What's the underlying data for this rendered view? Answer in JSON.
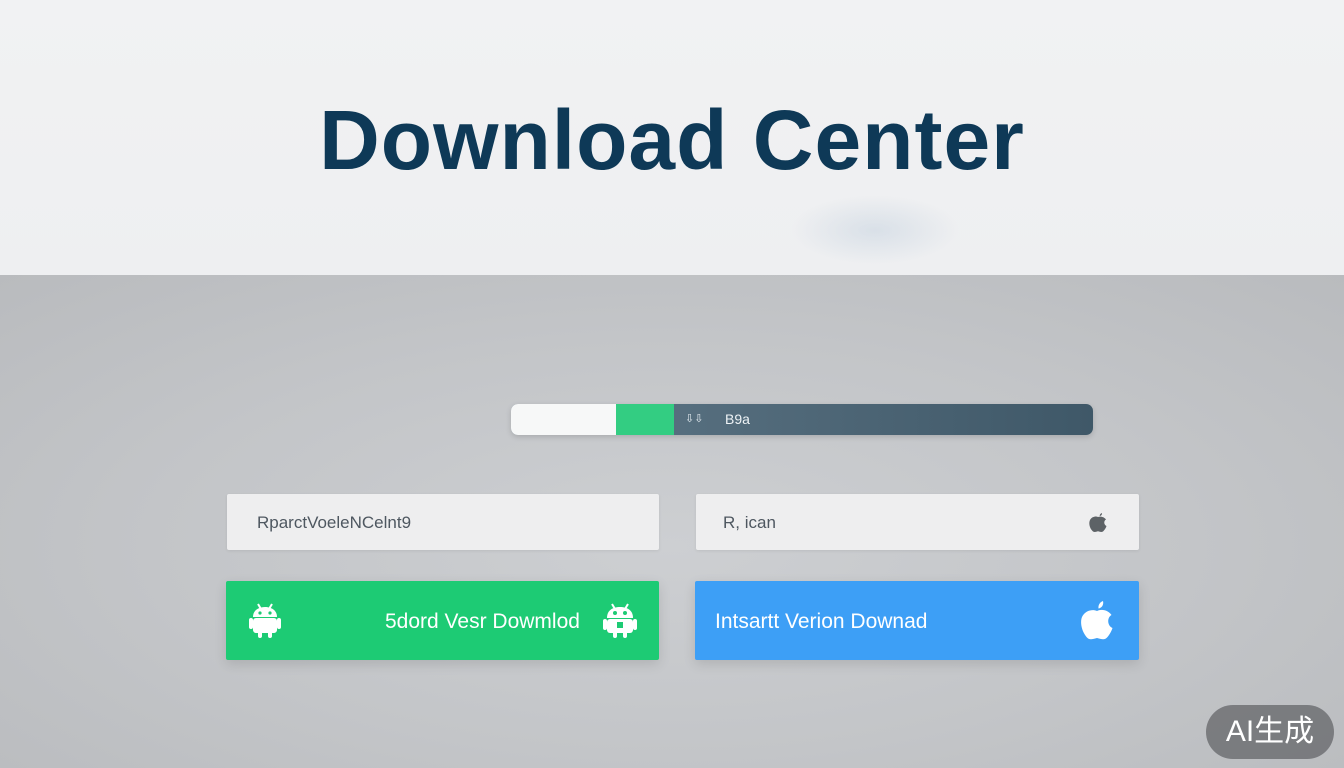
{
  "header": {
    "title": "Download Center"
  },
  "progress": {
    "fraction_white": 0.18,
    "fraction_fill": 0.28,
    "icon": "download-icon",
    "label": "B9a"
  },
  "versions": {
    "left_text": "RparctVoeleNCelnt9",
    "right_text": "R, ican",
    "right_icon": "apple-icon"
  },
  "buttons": {
    "android_label": "5dord Vesr Dowmlod",
    "android_icon": "android-icon",
    "ios_label": "Intsartt Verion Downad",
    "ios_icon": "apple-icon"
  },
  "watermark": {
    "text": "AI生成"
  },
  "colors": {
    "title": "#0e3957",
    "android_green": "#1dcb74",
    "ios_blue": "#3d9ff6",
    "progress_green": "#33cd82",
    "progress_track": "#4f6777"
  }
}
